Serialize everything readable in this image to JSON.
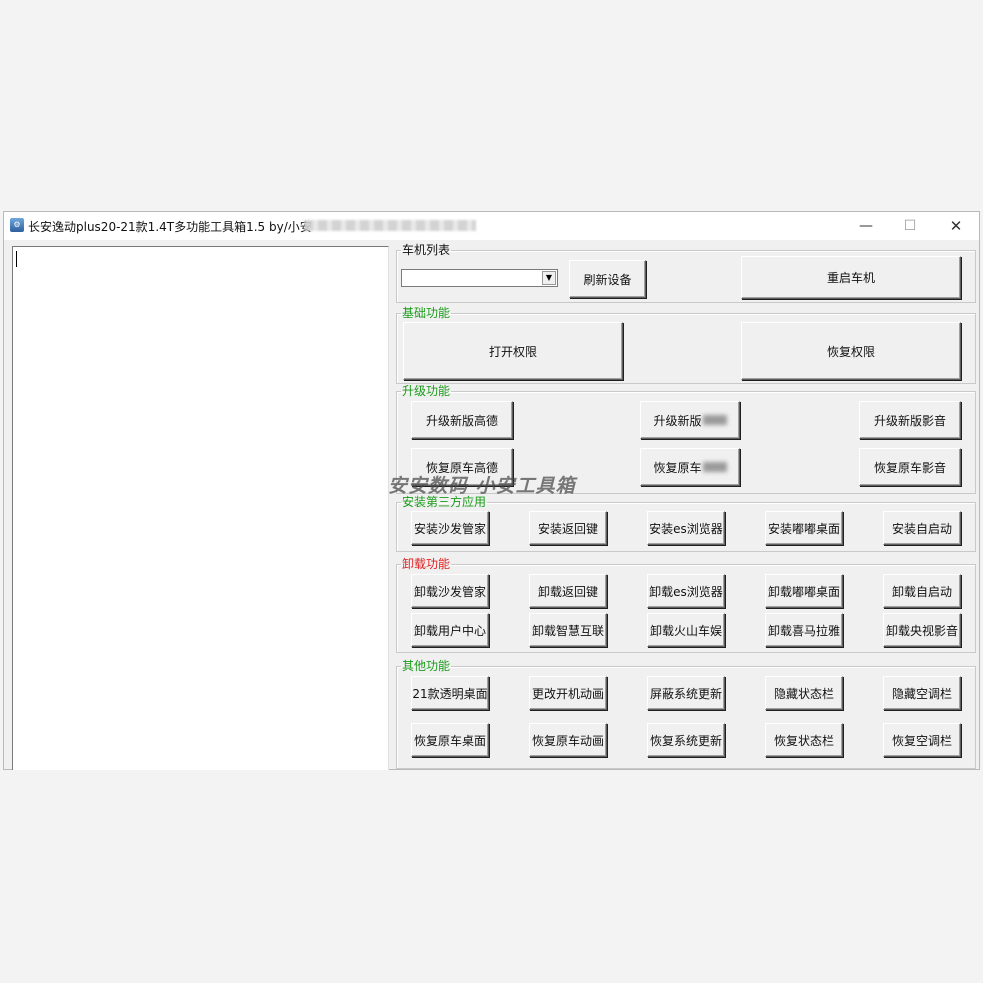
{
  "window": {
    "title": "长安逸动plus20-21款1.4T多功能工具箱1.5    by/小安",
    "icon": "app-icon",
    "controls": {
      "minimize": "—",
      "maximize": "☐",
      "close": "✕"
    }
  },
  "device_list": {
    "legend": "车机列表",
    "select_value": "",
    "refresh_label": "刷新设备",
    "reboot_label": "重启车机"
  },
  "basic": {
    "legend": "基础功能",
    "open_label": "打开权限",
    "restore_label": "恢复权限"
  },
  "upgrade": {
    "legend": "升级功能",
    "buttons": [
      "升级新版高德",
      "升级新版",
      "升级新版影音",
      "恢复原车高德",
      "恢复原车",
      "恢复原车影音"
    ]
  },
  "install": {
    "legend": "安装第三方应用",
    "buttons": [
      "安装沙发管家",
      "安装返回键",
      "安装es浏览器",
      "安装嘟嘟桌面",
      "安装自启动"
    ]
  },
  "uninstall": {
    "legend": "卸载功能",
    "buttons": [
      "卸载沙发管家",
      "卸载返回键",
      "卸载es浏览器",
      "卸载嘟嘟桌面",
      "卸载自启动",
      "卸载用户中心",
      "卸载智慧互联",
      "卸载火山车娱",
      "卸载喜马拉雅",
      "卸载央视影音"
    ]
  },
  "other": {
    "legend": "其他功能",
    "buttons": [
      "21款透明桌面",
      "更改开机动画",
      "屏蔽系统更新",
      "隐藏状态栏",
      "隐藏空调栏",
      "恢复原车桌面",
      "恢复原车动画",
      "恢复系统更新",
      "恢复状态栏",
      "恢复空调栏"
    ]
  },
  "watermark": "安安数码 小安工具箱",
  "colors": {
    "legend_green": "#1a9b1a",
    "legend_red": "#e02020"
  }
}
